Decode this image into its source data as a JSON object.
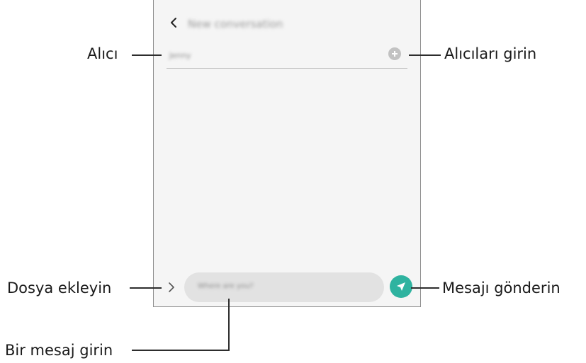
{
  "screen": {
    "title": "New conversation",
    "recipient_value": "Jenny",
    "message_placeholder": "Where are you?"
  },
  "callouts": {
    "recipient": "Alıcı",
    "enter_recipients": "Alıcıları girin",
    "attach_file": "Dosya ekleyin",
    "send_message": "Mesajı gönderin",
    "enter_message": "Bir mesaj girin"
  },
  "icons": {
    "back": "chevron-left-icon",
    "add_recipient": "plus-circle-icon",
    "attach": "chevron-right-icon",
    "send": "send-icon"
  },
  "colors": {
    "send_button": "#2fb3a0",
    "screen_background": "#f5f5f5",
    "input_background": "#e2e2e2"
  }
}
